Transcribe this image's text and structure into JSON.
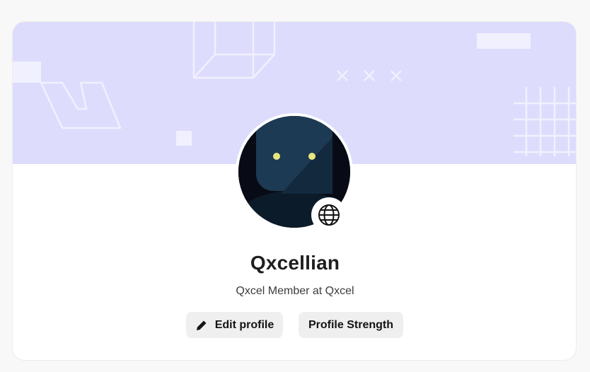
{
  "profile": {
    "name": "Qxcellian",
    "subtitle": "Qxcel Member at Qxcel"
  },
  "actions": {
    "edit_label": "Edit profile",
    "strength_label": "Profile Strength"
  },
  "icons": {
    "edit": "pencil-icon",
    "visibility": "globe-icon"
  },
  "colors": {
    "banner": "#dedcfd",
    "button_bg": "#efefef",
    "avatar_face": "#1d3a54",
    "avatar_eyes": "#e8e67e"
  }
}
